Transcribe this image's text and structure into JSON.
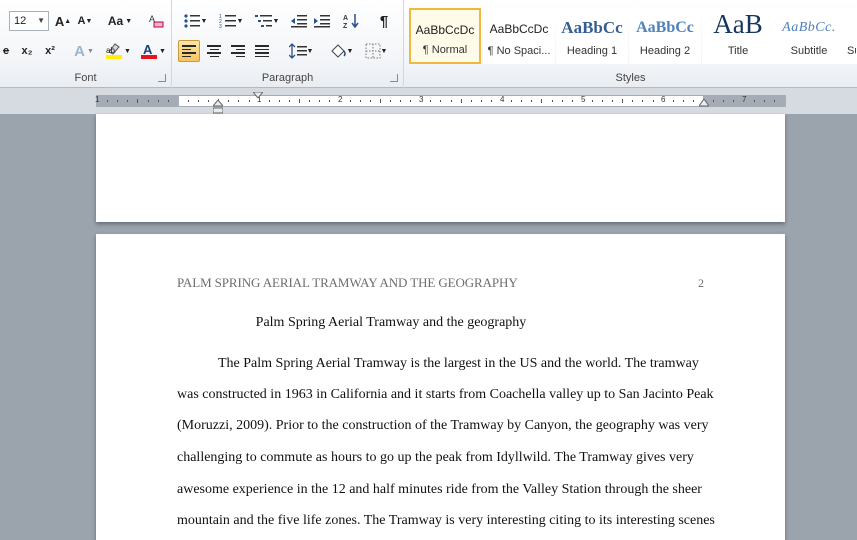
{
  "ribbon": {
    "font_group": {
      "label": "Font",
      "size_value": "12",
      "grow_font": "A",
      "shrink_font": "A",
      "change_case": "Aa",
      "clear_formatting": "A",
      "subscript": "x₂",
      "superscript": "x²",
      "text_effects": "A",
      "highlight": "ab",
      "font_color": "A"
    },
    "paragraph_group": {
      "label": "Paragraph",
      "pilcrow": "¶"
    },
    "styles_group": {
      "label": "Styles",
      "tiles": [
        {
          "sample": "AaBbCcDc",
          "name": "¶ Normal"
        },
        {
          "sample": "AaBbCcDc",
          "name": "¶ No Spaci..."
        },
        {
          "sample": "AaBbCc",
          "name": "Heading 1"
        },
        {
          "sample": "AaBbCc",
          "name": "Heading 2"
        },
        {
          "sample": "AaB",
          "name": "Title"
        },
        {
          "sample": "AaBbCc.",
          "name": "Subtitle"
        },
        {
          "sample": "",
          "name": "Su"
        }
      ]
    }
  },
  "ruler": {
    "numbers": [
      "1",
      "1",
      "2",
      "3",
      "4",
      "5",
      "6",
      "7"
    ]
  },
  "document": {
    "running_head": "PALM SPRING AERIAL TRAMWAY AND THE GEOGRAPHY",
    "page_number": "2",
    "title": "Palm Spring Aerial Tramway and the geography",
    "lines": [
      "The Palm Spring Aerial Tramway is the largest in the US and the world. The tramway",
      "was constructed in 1963 in California and it starts from Coachella valley up to San Jacinto Peak",
      "(Moruzzi, 2009). Prior to the construction of the Tramway by Canyon, the geography was very",
      "challenging to commute as hours to go up the peak from Idyllwild. The Tramway gives very",
      "awesome experience in the 12 and half minutes ride from the Valley Station through the sheer",
      "mountain and the five life zones. The Tramway is very interesting citing to its interesting scenes"
    ]
  },
  "colors": {
    "highlight": "#ffef00",
    "font_color": "#e3141c",
    "heading": "#365f91",
    "active_button": "#f8c45c"
  }
}
